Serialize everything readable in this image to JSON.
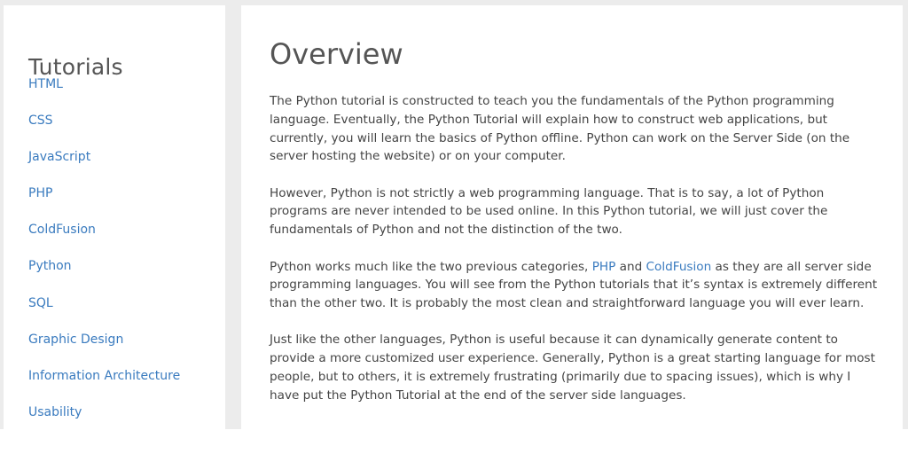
{
  "sidebar": {
    "title": "Tutorials",
    "items": [
      {
        "label": "HTML"
      },
      {
        "label": "CSS"
      },
      {
        "label": "JavaScript"
      },
      {
        "label": "PHP"
      },
      {
        "label": "ColdFusion"
      },
      {
        "label": "Python"
      },
      {
        "label": "SQL"
      },
      {
        "label": "Graphic Design"
      },
      {
        "label": "Information Architecture"
      },
      {
        "label": "Usability"
      }
    ]
  },
  "main": {
    "title": "Overview",
    "p1": "The Python tutorial is constructed to teach you the fundamentals of the Python programming language. Eventually, the Python Tutorial will explain how to construct web applications, but currently, you will learn the basics of Python offline. Python can work on the Server Side (on the server hosting the website) or on your computer.",
    "p2": "However, Python is not strictly a web programming language. That is to say, a lot of Python programs are never intended to be used online. In this Python tutorial, we will just cover the fundamentals of Python and not the distinction of the two.",
    "p3_before": "Python works much like the two previous categories, ",
    "p3_link1": "PHP",
    "p3_and": " and ",
    "p3_link2": "ColdFusion",
    "p3_after": " as they are all server side programming languages. You will see from the Python tutorials that it’s syntax is extremely different than the other two. It is probably the most clean and straightforward language you will ever learn.",
    "p4": "Just like the other languages, Python is useful because it can dynamically generate content to provide a more customized user experience. Generally, Python is a great starting language for most people, but to others, it is extremely frustrating (primarily due to spacing issues), which is why I have put the Python Tutorial at the end of the server side languages."
  },
  "colors": {
    "link": "#3a7bbf",
    "text": "#444444",
    "heading": "#555555",
    "frame_bg": "#ececec"
  }
}
